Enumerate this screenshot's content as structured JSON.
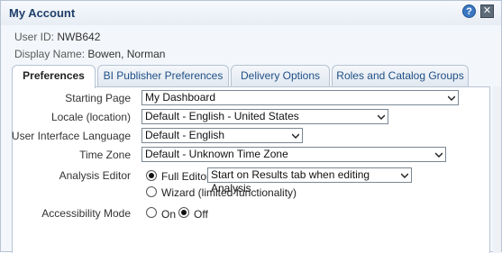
{
  "dialog": {
    "title": "My Account",
    "help_icon": "help-icon",
    "close_icon": "close-icon"
  },
  "account": {
    "user_id_label": "User ID:",
    "user_id_value": "NWB642",
    "display_name_label": "Display Name:",
    "display_name_value": "Bowen, Norman"
  },
  "tabs": [
    {
      "label": "Preferences",
      "active": true
    },
    {
      "label": "BI Publisher Preferences",
      "active": false
    },
    {
      "label": "Delivery Options",
      "active": false
    },
    {
      "label": "Roles and Catalog Groups",
      "active": false
    }
  ],
  "preferences": {
    "starting_page": {
      "label": "Starting Page",
      "value": "My Dashboard"
    },
    "locale": {
      "label": "Locale (location)",
      "value": "Default - English - United States"
    },
    "ui_language": {
      "label": "User Interface Language",
      "value": "Default - English"
    },
    "time_zone": {
      "label": "Time Zone",
      "value": "Default - Unknown Time Zone"
    },
    "analysis_editor": {
      "label": "Analysis Editor",
      "full_editor_label": "Full Editor",
      "full_editor_checked": true,
      "full_editor_option": "Start on Results tab when editing Analysis",
      "wizard_label": "Wizard (limited functionality)",
      "wizard_checked": false
    },
    "accessibility_mode": {
      "label": "Accessibility Mode",
      "on_label": "On",
      "on_checked": false,
      "off_label": "Off",
      "off_checked": true
    }
  },
  "colors": {
    "accent": "#1f4f86",
    "border": "#b7c4d3",
    "title": "#1f3f6a"
  }
}
